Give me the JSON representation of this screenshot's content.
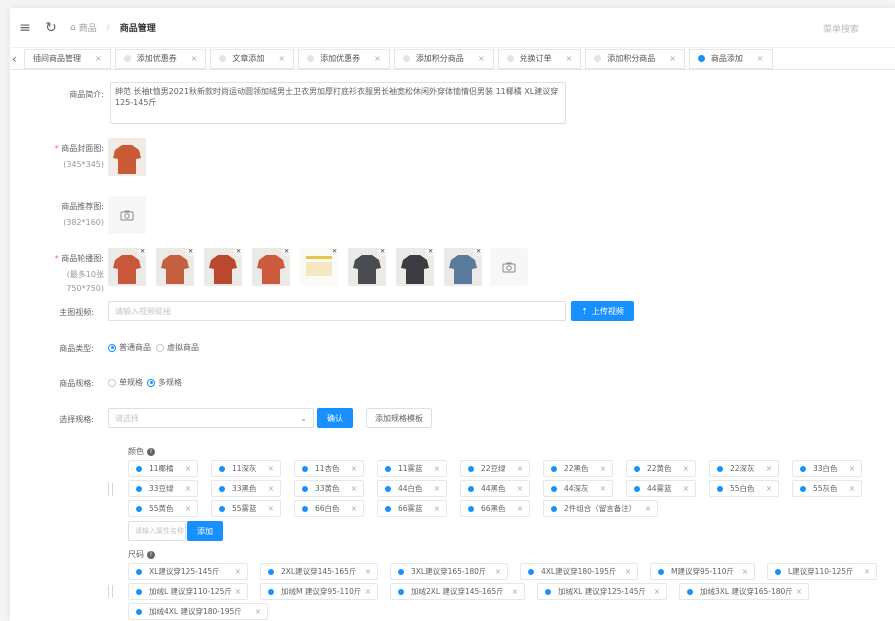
{
  "header": {
    "breadcrumb_root": "商品",
    "breadcrumb_sep": "/",
    "breadcrumb_current": "商品管理",
    "menu_search": "菜单搜索"
  },
  "tabs": [
    {
      "label": "插间商品管理",
      "active": false
    },
    {
      "label": "添加优惠券",
      "active": false
    },
    {
      "label": "文章添加",
      "active": false
    },
    {
      "label": "添加优惠券",
      "active": false
    },
    {
      "label": "添加积分商品",
      "active": false
    },
    {
      "label": "兑换订单",
      "active": false
    },
    {
      "label": "添加积分商品",
      "active": false
    },
    {
      "label": "商品添加",
      "active": true
    }
  ],
  "form": {
    "intro_label": "商品简介:",
    "intro_value": "绅范 长袖t恤男2021秋新款时尚运动圆领加绒男士卫衣男加厚打底衫衣服男长袖宽松休闲外穿体恤情侣男装 11椰橘 XL建议穿125-145斤",
    "cover_label": "商品封面图:",
    "cover_hint": "(345*345)",
    "recommend_label": "商品推荐图:",
    "recommend_hint": "(382*160)",
    "carousel_label": "商品轮播图:",
    "carousel_hint1": "(最多10张",
    "carousel_hint2": "750*750)",
    "video_label": "主图视频:",
    "video_placeholder": "请输入视频链接",
    "upload_video_btn": "上传视频",
    "type_label": "商品类型:",
    "type_options": [
      "普通商品",
      "虚拟商品"
    ],
    "type_selected": 0,
    "spec_label": "商品规格:",
    "spec_options": [
      "单规格",
      "多规格"
    ],
    "spec_selected": 1,
    "select_spec_label": "选择规格:",
    "select_placeholder": "请选择",
    "confirm_btn": "确认",
    "add_template_btn": "添加规格模板"
  },
  "colors": {
    "accent": "#1890ff",
    "required": "#f56c6c"
  },
  "attributes": {
    "color_title": "颜色",
    "color_values": [
      "11椰橘",
      "11深灰",
      "11杏色",
      "11雾蓝",
      "22豆绿",
      "22黑色",
      "22黄色",
      "22深灰",
      "33白色",
      "33豆绿",
      "33黑色",
      "33黄色",
      "44白色",
      "44黑色",
      "44深灰",
      "44雾蓝",
      "55白色",
      "55灰色",
      "55黄色",
      "55雾蓝",
      "66白色",
      "66雾蓝",
      "66黑色",
      "2件组合（留言备注）"
    ],
    "attr_placeholder": "请输入属性名称",
    "add_btn": "添加",
    "size_title": "尺码",
    "size_values": [
      "XL建议穿125-145斤",
      "2XL建议穿145-165斤",
      "3XL建议穿165-180斤",
      "4XL建议穿180-195斤",
      "M建议穿95-110斤",
      "L建议穿110-125斤",
      "加绒L 建议穿110-125斤",
      "加绒M 建议穿95-110斤",
      "加绒2XL 建议穿145-165斤",
      "加绒XL 建议穿125-145斤",
      "加绒3XL 建议穿165-180斤",
      "加绒4XL 建议穿180-195斤"
    ]
  },
  "icons": {
    "menu": "hamburger-icon",
    "refresh": "refresh-icon",
    "home": "home-icon",
    "camera": "camera-icon",
    "info": "info-icon"
  },
  "images": {
    "cover": "orange shirt",
    "carousel": [
      "orange shirt",
      "orange shirt back",
      "orange fabric",
      "orange shirt flat",
      "size chart",
      "gray shirt",
      "dark gray shirt",
      "blue shirt"
    ]
  }
}
